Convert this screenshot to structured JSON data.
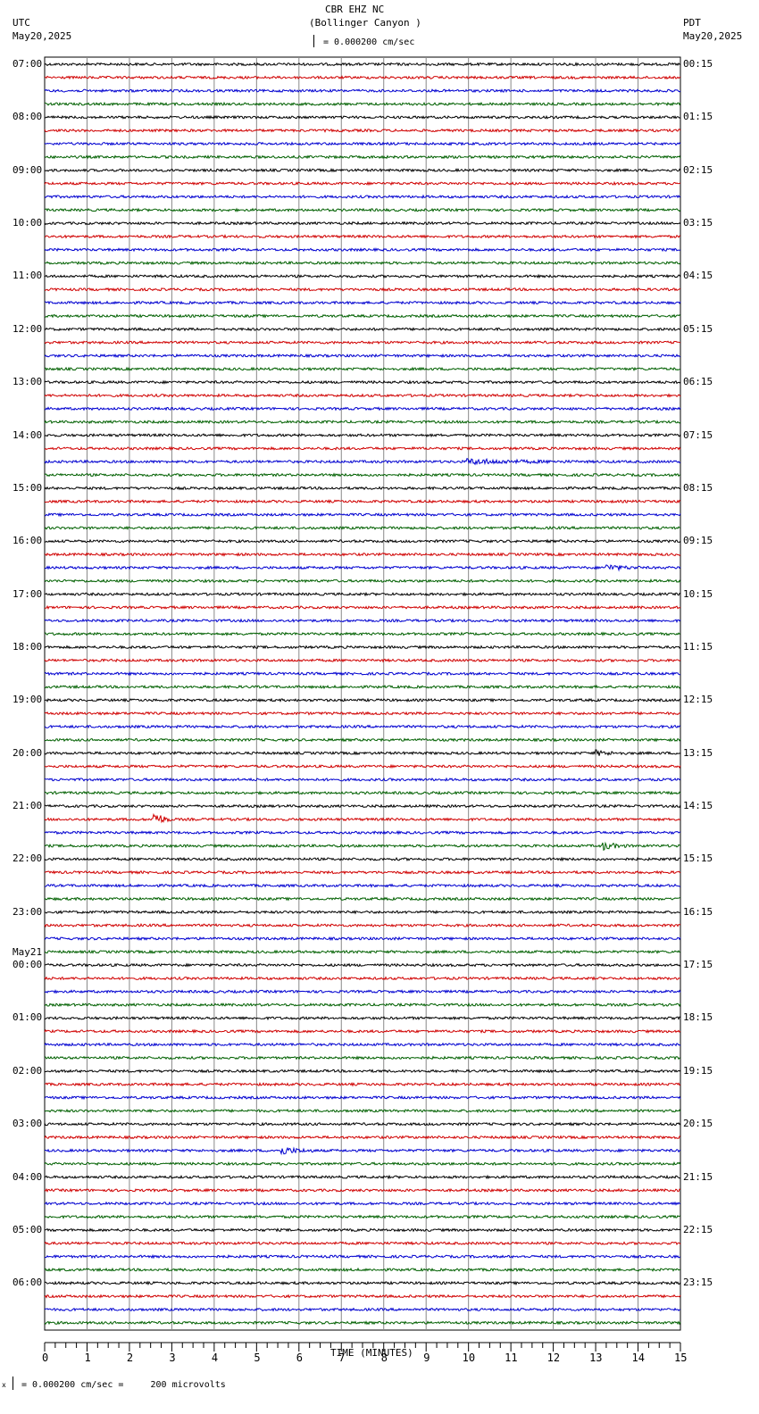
{
  "header": {
    "station": "CBR EHZ NC",
    "location": "(Bollinger Canyon )",
    "scale_text": "= 0.000200 cm/sec",
    "left_tz": "UTC",
    "left_date": "May20,2025",
    "right_tz": "PDT",
    "right_date": "May20,2025"
  },
  "footer": {
    "scale_text": "= 0.000200 cm/sec =     200 microvolts",
    "mark": "x"
  },
  "chart_data": {
    "type": "line",
    "title": "CBR EHZ NC (Bollinger Canyon )",
    "xlabel": "TIME (MINUTES)",
    "xlim": [
      0,
      15
    ],
    "x_ticks": [
      "0",
      "1",
      "2",
      "3",
      "4",
      "5",
      "6",
      "7",
      "8",
      "9",
      "10",
      "11",
      "12",
      "13",
      "14",
      "15"
    ],
    "traces_per_hour": 4,
    "trace_colors": [
      "#000000",
      "#d00000",
      "#0000d0",
      "#006000"
    ],
    "utc_labels": [
      "07:00",
      "08:00",
      "09:00",
      "10:00",
      "11:00",
      "12:00",
      "13:00",
      "14:00",
      "15:00",
      "16:00",
      "17:00",
      "18:00",
      "19:00",
      "20:00",
      "21:00",
      "22:00",
      "23:00",
      "00:00",
      "01:00",
      "02:00",
      "03:00",
      "04:00",
      "05:00",
      "06:00"
    ],
    "date_change_label": "May21",
    "date_change_index": 17,
    "pdt_labels": [
      "00:15",
      "01:15",
      "02:15",
      "03:15",
      "04:15",
      "05:15",
      "06:15",
      "07:15",
      "08:15",
      "09:15",
      "10:15",
      "11:15",
      "12:15",
      "13:15",
      "14:15",
      "15:15",
      "16:15",
      "17:15",
      "18:15",
      "19:15",
      "20:15",
      "21:15",
      "22:15",
      "23:15"
    ],
    "events": [
      {
        "trace": 57,
        "minute": 2.6,
        "amplitude": 9,
        "duration": 0.4
      },
      {
        "trace": 59,
        "minute": 13.2,
        "amplitude": 4,
        "duration": 0.6
      },
      {
        "trace": 82,
        "minute": 5.6,
        "amplitude": 4,
        "duration": 0.8
      },
      {
        "trace": 38,
        "minute": 13.3,
        "amplitude": 3,
        "duration": 0.8
      },
      {
        "trace": 30,
        "minute": 10.0,
        "amplitude": 2.5,
        "duration": 2.5
      },
      {
        "trace": 52,
        "minute": 13.0,
        "amplitude": 2.5,
        "duration": 0.8
      }
    ]
  }
}
